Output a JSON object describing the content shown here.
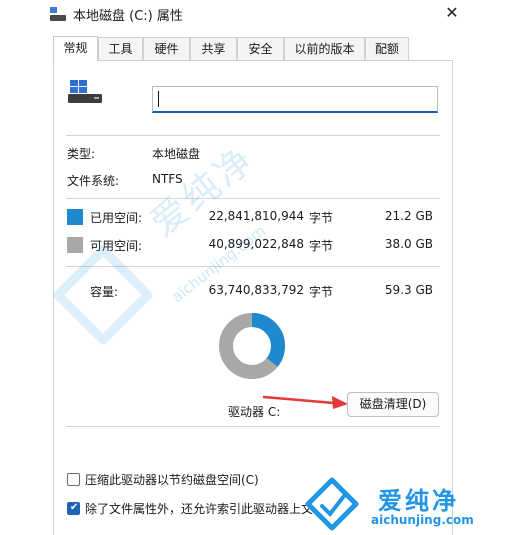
{
  "window": {
    "title": "本地磁盘 (C:) 属性",
    "close_glyph": "✕"
  },
  "tabs": [
    {
      "label": "常规",
      "active": true
    },
    {
      "label": "工具"
    },
    {
      "label": "硬件"
    },
    {
      "label": "共享"
    },
    {
      "label": "安全"
    },
    {
      "label": "以前的版本"
    },
    {
      "label": "配额"
    }
  ],
  "drive": {
    "name_value": "",
    "icon": "drive-icon"
  },
  "info": {
    "type_label": "类型:",
    "type_value": "本地磁盘",
    "fs_label": "文件系统:",
    "fs_value": "NTFS"
  },
  "space": {
    "used": {
      "label": "已用空间:",
      "bytes": "22,841,810,944",
      "unit": "字节",
      "gb": "21.2 GB",
      "color": "#1e88d0"
    },
    "free": {
      "label": "可用空间:",
      "bytes": "40,899,022,848",
      "unit": "字节",
      "gb": "38.0 GB",
      "color": "#a8a8a8"
    },
    "total": {
      "label": "容量:",
      "bytes": "63,740,833,792",
      "unit": "字节",
      "gb": "59.3 GB"
    },
    "used_fraction": 0.358
  },
  "drive_label": "驱动器 C:",
  "cleanup_button": "磁盘清理(D)",
  "options": {
    "compress": {
      "label": "压缩此驱动器以节约磁盘空间(C)",
      "checked": false
    },
    "index": {
      "label": "除了文件属性外，还允许索引此驱动器上文",
      "checked": true
    }
  },
  "watermark": {
    "text": "爱纯净",
    "url": "aichunjing.com"
  },
  "colors": {
    "accent": "#1e63b8",
    "arrow": "#e53935"
  }
}
